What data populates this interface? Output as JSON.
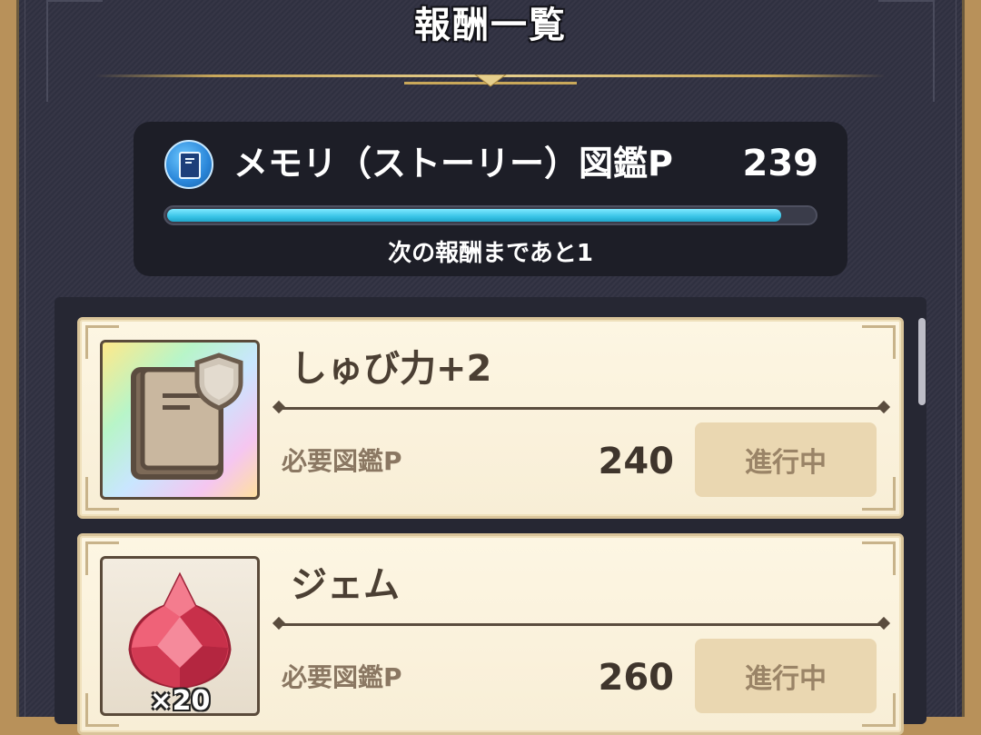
{
  "header": {
    "title": "報酬一覧"
  },
  "points": {
    "icon": "book-icon",
    "label": "メモリ（ストーリー）図鑑P",
    "value": "239",
    "progress_fraction": 0.95,
    "next_reward_text": "次の報酬まであと1",
    "accent_color": "#38c4e6"
  },
  "rewards": [
    {
      "icon": "defense-book-icon",
      "name": "しゅび力+2",
      "required_label": "必要図鑑P",
      "required_value": "240",
      "status_label": "進行中"
    },
    {
      "icon": "gem-icon",
      "name": "ジェム",
      "quantity": "×20",
      "required_label": "必要図鑑P",
      "required_value": "260",
      "status_label": "進行中"
    }
  ]
}
